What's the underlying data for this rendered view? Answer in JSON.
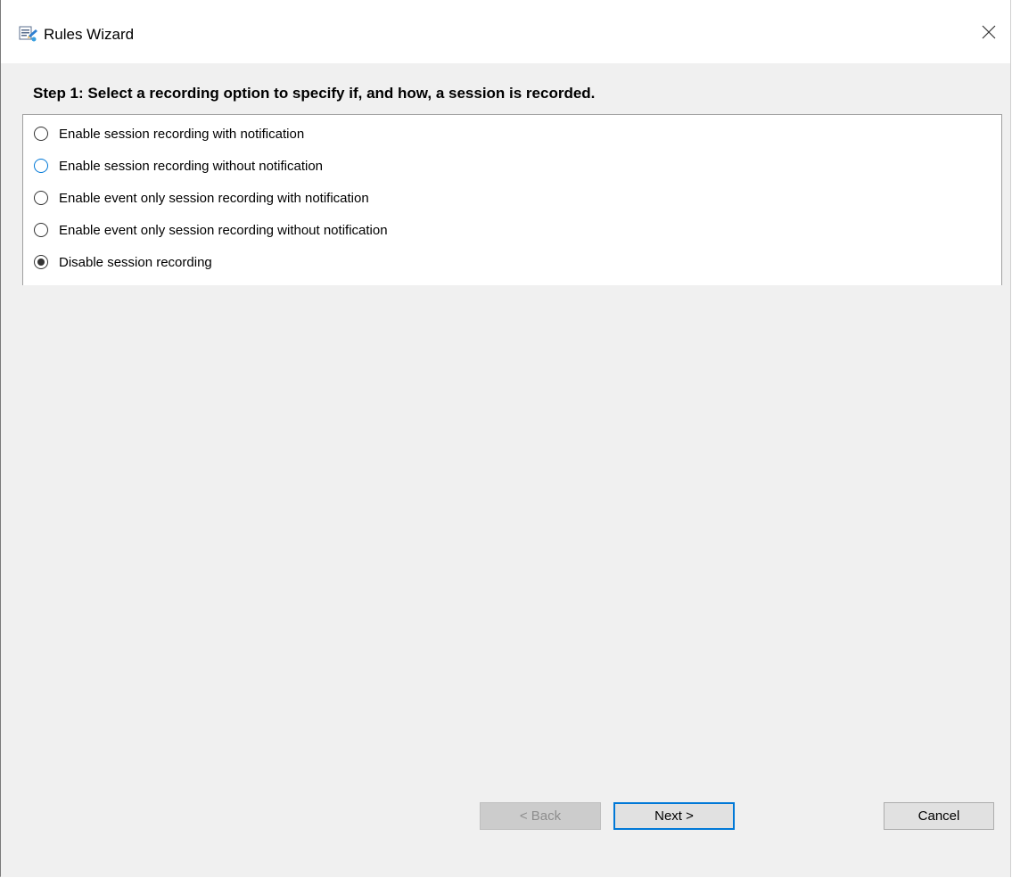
{
  "window": {
    "title": "Rules Wizard"
  },
  "step": {
    "heading": "Step 1: Select a recording option to specify if, and how, a session is recorded."
  },
  "options": [
    {
      "label": "Enable session recording with notification",
      "selected": false
    },
    {
      "label": "Enable session recording without notification",
      "selected": false
    },
    {
      "label": "Enable event only session recording with notification",
      "selected": false
    },
    {
      "label": "Enable event only session recording without notification",
      "selected": false
    },
    {
      "label": "Disable session recording",
      "selected": true
    }
  ],
  "buttons": {
    "back": "< Back",
    "next": "Next >",
    "cancel": "Cancel"
  },
  "icons": {
    "app": "rules-wizard-icon",
    "close": "close-icon"
  },
  "colors": {
    "accent": "#0078d7",
    "background": "#f0f0f0"
  }
}
